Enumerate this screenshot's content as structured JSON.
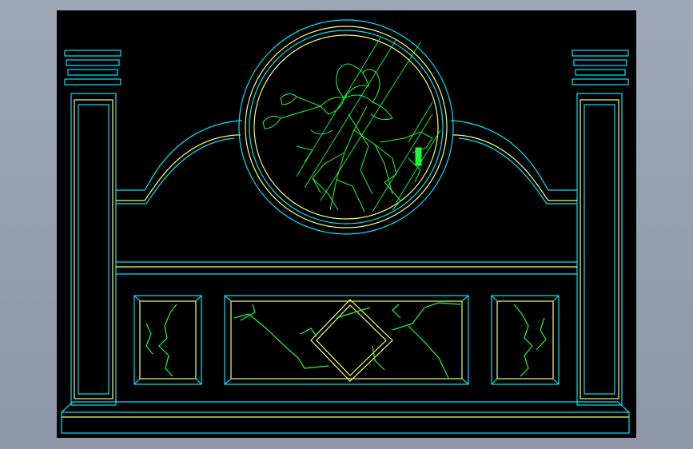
{
  "app": {
    "title": ""
  },
  "colors": {
    "background": "#000000",
    "chrome": "#9aa3b3",
    "outline_cyan": "#00e5ff",
    "outline_yellow": "#f4ff6a",
    "carving_green": "#19ff3a"
  },
  "drawing": {
    "subject": "",
    "elements": [
      "left-pillar",
      "right-pillar",
      "base-plinth",
      "arched-top-rail",
      "round-window-with-flower-carving",
      "horizontal-beam",
      "left-marble-panel",
      "center-marble-panel",
      "right-marble-panel"
    ]
  }
}
